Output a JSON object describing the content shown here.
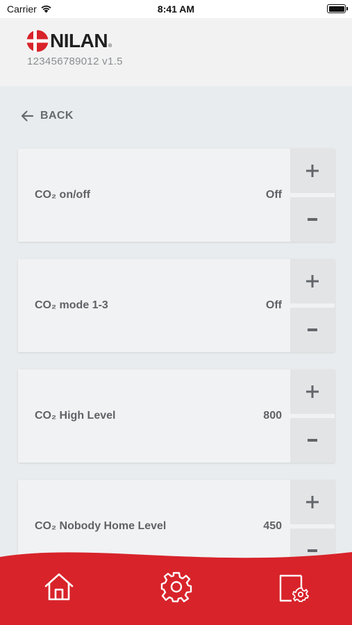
{
  "status_bar": {
    "carrier": "Carrier",
    "time": "8:41 AM"
  },
  "header": {
    "brand": "NILAN",
    "brand_registered": "®",
    "device_id": "123456789012 v1.5"
  },
  "back": {
    "label": "BACK"
  },
  "settings": [
    {
      "label": "CO₂ on/off",
      "value": "Off"
    },
    {
      "label": "CO₂ mode 1-3",
      "value": "Off"
    },
    {
      "label": "CO₂ High Level",
      "value": "800"
    },
    {
      "label": "CO₂ Nobody Home Level",
      "value": "450"
    }
  ],
  "bottom_nav": {
    "items": [
      "home-icon",
      "gear-icon",
      "device-settings-icon"
    ]
  },
  "colors": {
    "accent_red": "#d8232a",
    "background": "#e9ecee",
    "header_bg": "#f2f2f2",
    "card_bg": "#f1f2f3",
    "button_bg": "#e3e4e5",
    "text": "#5f6266"
  }
}
